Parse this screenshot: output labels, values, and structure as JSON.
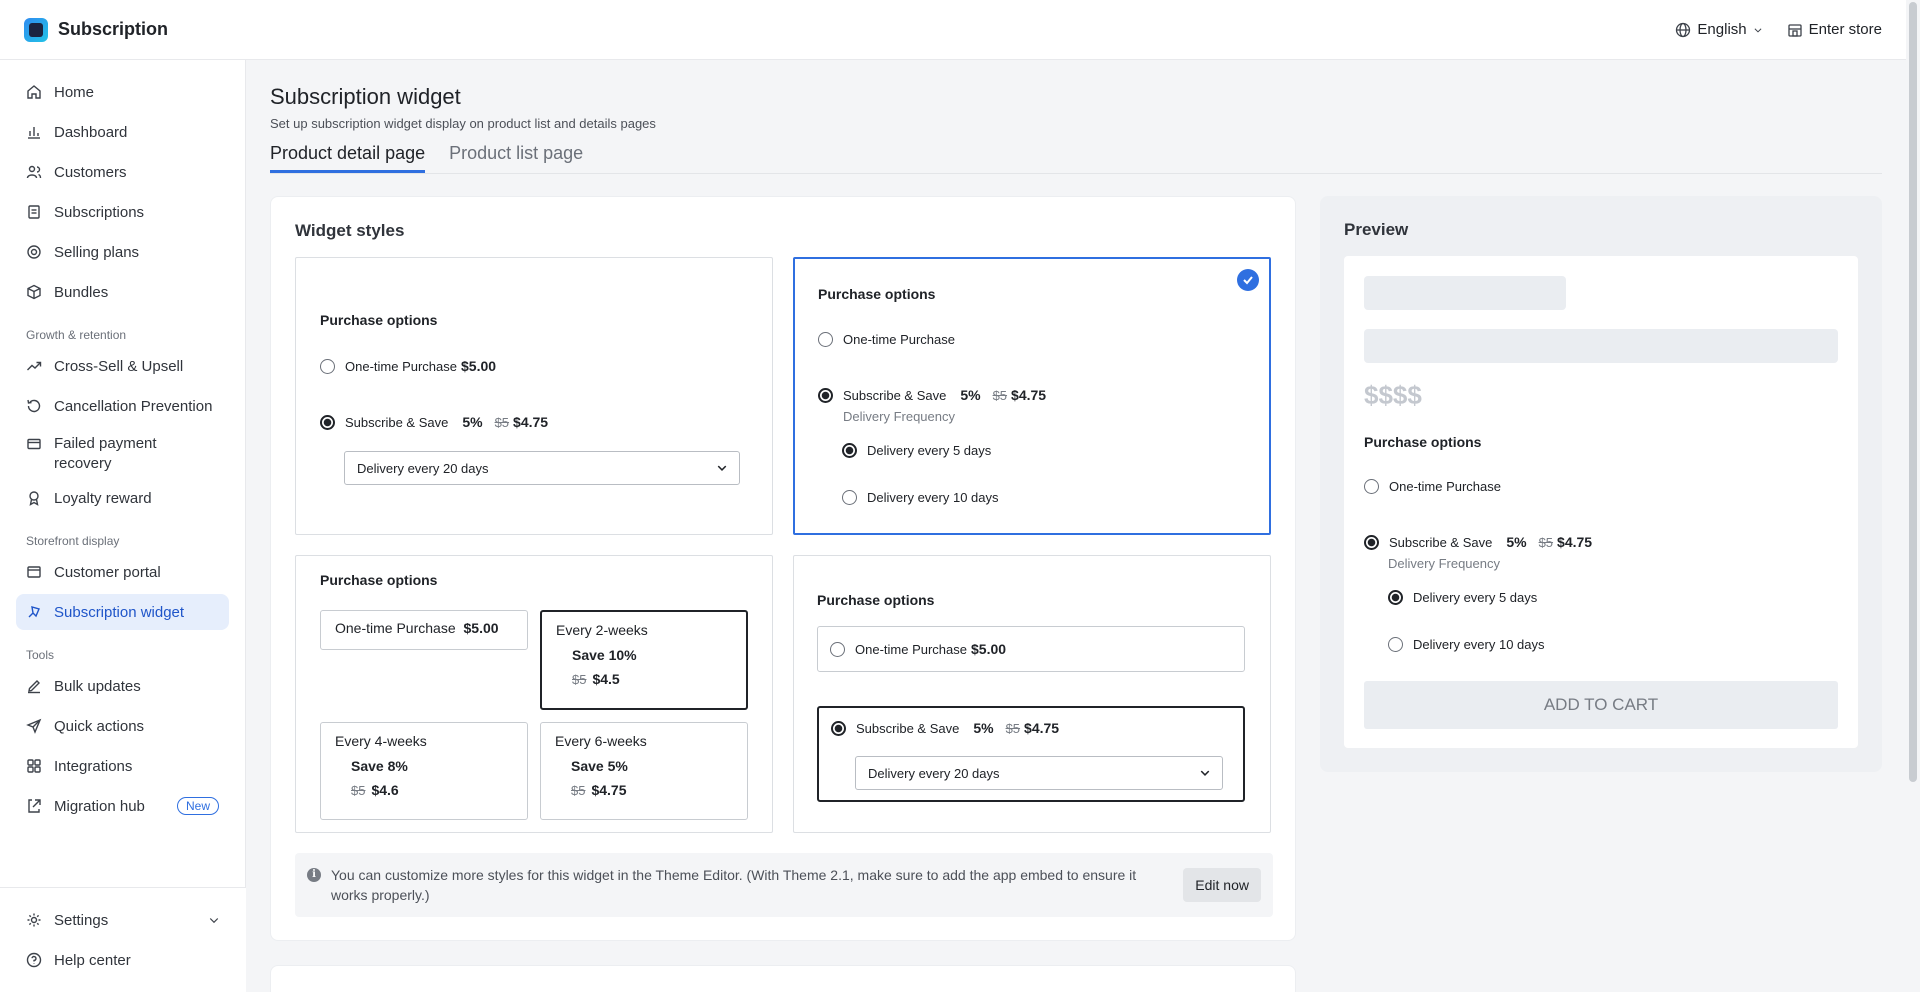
{
  "app": {
    "title": "Subscription"
  },
  "topbar": {
    "language": "English",
    "enter_store": "Enter store"
  },
  "sidebar": {
    "items": [
      {
        "label": "Home"
      },
      {
        "label": "Dashboard"
      },
      {
        "label": "Customers"
      },
      {
        "label": "Subscriptions"
      },
      {
        "label": "Selling plans"
      },
      {
        "label": "Bundles"
      }
    ],
    "growth_section": "Growth & retention",
    "growth_items": [
      {
        "label": "Cross-Sell & Upsell"
      },
      {
        "label": "Cancellation Prevention"
      },
      {
        "label": "Failed payment recovery"
      },
      {
        "label": "Loyalty reward"
      }
    ],
    "storefront_section": "Storefront display",
    "storefront_items": [
      {
        "label": "Customer portal"
      },
      {
        "label": "Subscription widget"
      }
    ],
    "tools_section": "Tools",
    "tools_items": [
      {
        "label": "Bulk updates"
      },
      {
        "label": "Quick actions"
      },
      {
        "label": "Integrations"
      },
      {
        "label": "Migration hub",
        "badge": "New"
      }
    ],
    "bottom_items": [
      {
        "label": "Settings"
      },
      {
        "label": "Help center"
      }
    ]
  },
  "page": {
    "title": "Subscription widget",
    "subtitle": "Set up subscription widget display on product list and details pages",
    "tabs": [
      {
        "label": "Product detail page",
        "active": true
      },
      {
        "label": "Product list page",
        "active": false
      }
    ]
  },
  "widget_styles": {
    "heading": "Widget styles",
    "common": {
      "purchase_options": "Purchase options",
      "one_time": "One-time Purchase",
      "one_time_price": "$5.00",
      "subscribe": "Subscribe & Save",
      "pct": "5%",
      "old_price": "$5",
      "new_price": "$4.75",
      "delivery_frequency": "Delivery Frequency",
      "every_5": "Delivery every 5 days",
      "every_10": "Delivery every 10 days",
      "every_20": "Delivery every 20 days"
    },
    "tiles": [
      {
        "label": "Every 2-weeks",
        "save": "Save 10%",
        "old": "$5",
        "new": "$4.5",
        "selected": true
      },
      {
        "label": "Every 4-weeks",
        "save": "Save 8%",
        "old": "$5",
        "new": "$4.6",
        "selected": false
      },
      {
        "label": "Every 6-weeks",
        "save": "Save 5%",
        "old": "$5",
        "new": "$4.75",
        "selected": false
      }
    ],
    "selected_style": 2
  },
  "notice": {
    "text": "You can customize more styles for this widget in the Theme Editor. (With Theme 2.1, make sure to add the app embed to ensure it works properly.)",
    "button": "Edit now"
  },
  "preview": {
    "heading": "Preview",
    "price_placeholder": "$$$$",
    "add_to_cart": "ADD TO CART"
  },
  "colors": {
    "accent": "#2f6fe0",
    "active_nav_bg": "#e6eefc"
  }
}
